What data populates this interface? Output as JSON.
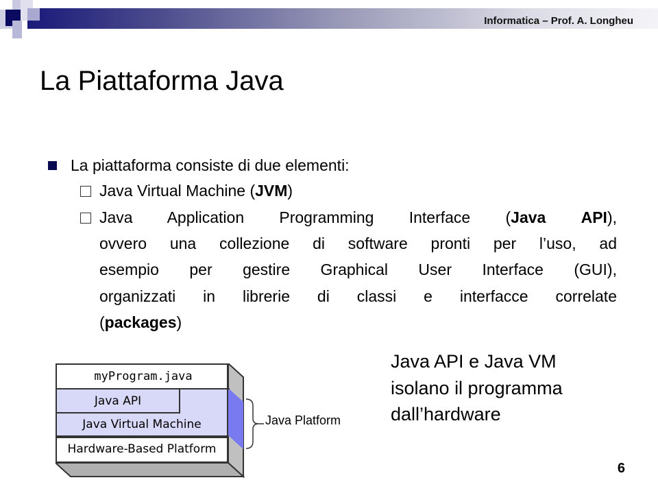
{
  "header": {
    "course": "Informatica – Prof. A. Longheu"
  },
  "slide": {
    "title": "La Piattaforma Java",
    "bullet": "La piattaforma consiste di due elementi:",
    "sub1": {
      "pre": "Java Virtual Machine (",
      "bold": "JVM",
      "post": ")"
    },
    "sub2": {
      "line1_pre": "Java Application Programming Interface (",
      "line1_bold1": "Java",
      "line1_mid": " ",
      "line1_bold2": "API",
      "line1_post": "),",
      "line2": "ovvero una collezione di software pronti per l’uso, ad",
      "line3": "esempio per gestire  Graphical User Interface (GUI),",
      "line4": "organizzati in librerie di classi e interfacce correlate",
      "line5_pre": "(",
      "line5_bold": "packages",
      "line5_post": ")"
    },
    "note": [
      "Java API e Java VM",
      "isolano il programma",
      "dall’hardware"
    ],
    "page_number": "6"
  },
  "diagram": {
    "layers": [
      "myProgram.java",
      "Java API",
      "Java Virtual Machine",
      "Hardware-Based Platform"
    ],
    "brace_label": "Java Platform",
    "colors": {
      "platform_fill": "#d8d8f8",
      "side_highlight": "#7a7af0",
      "side": "#c0c0c0"
    }
  }
}
